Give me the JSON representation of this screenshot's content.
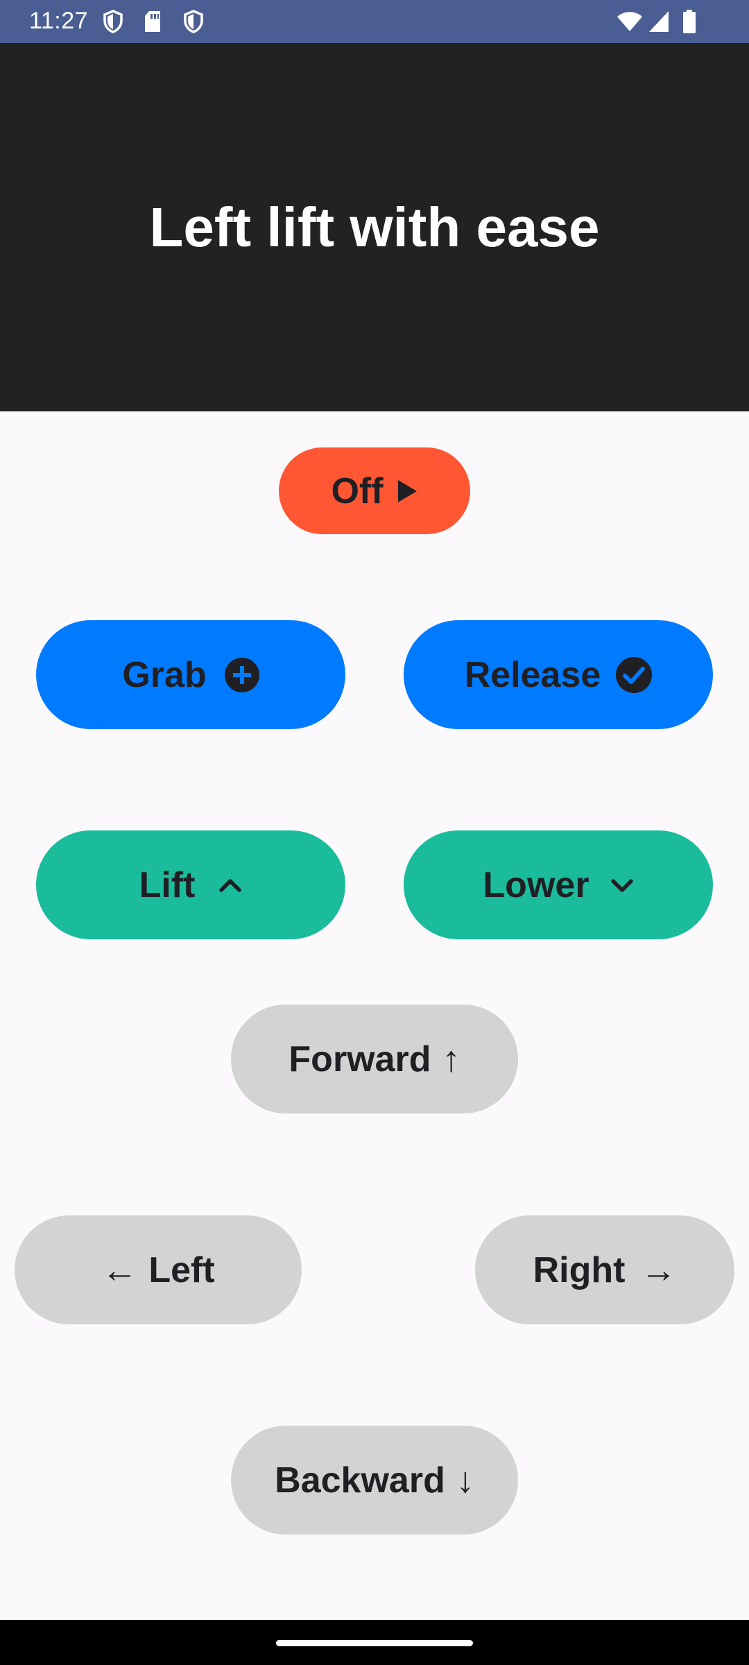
{
  "status_bar": {
    "time": "11:27",
    "left_icons": [
      "shield-icon",
      "sd-card-icon",
      "shield-icon"
    ],
    "right_icons": [
      "wifi-icon",
      "signal-icon",
      "battery-icon"
    ],
    "color": "#4B5E93"
  },
  "header": {
    "title": "Left lift with ease",
    "background": "#222223"
  },
  "buttons": {
    "off": {
      "label": "Off",
      "icon": "play-icon",
      "color": "#FF5733"
    },
    "grab": {
      "label": "Grab",
      "icon": "add-circle-icon",
      "color": "#007BFF"
    },
    "release": {
      "label": "Release",
      "icon": "check-circle-icon",
      "color": "#007BFF"
    },
    "lift": {
      "label": "Lift",
      "icon": "chevron-up-icon",
      "color": "#1ABC9C"
    },
    "lower": {
      "label": "Lower",
      "icon": "chevron-down-icon",
      "color": "#1ABC9C"
    },
    "forward": {
      "label": "Forward",
      "arrow": "↑",
      "color": "#D3D3D3"
    },
    "left": {
      "label": "Left",
      "arrow": "←",
      "color": "#D3D3D3"
    },
    "right": {
      "label": "Right",
      "arrow": "→",
      "color": "#D3D3D3"
    },
    "backward": {
      "label": "Backward",
      "arrow": "↓",
      "color": "#D3D3D3"
    }
  }
}
